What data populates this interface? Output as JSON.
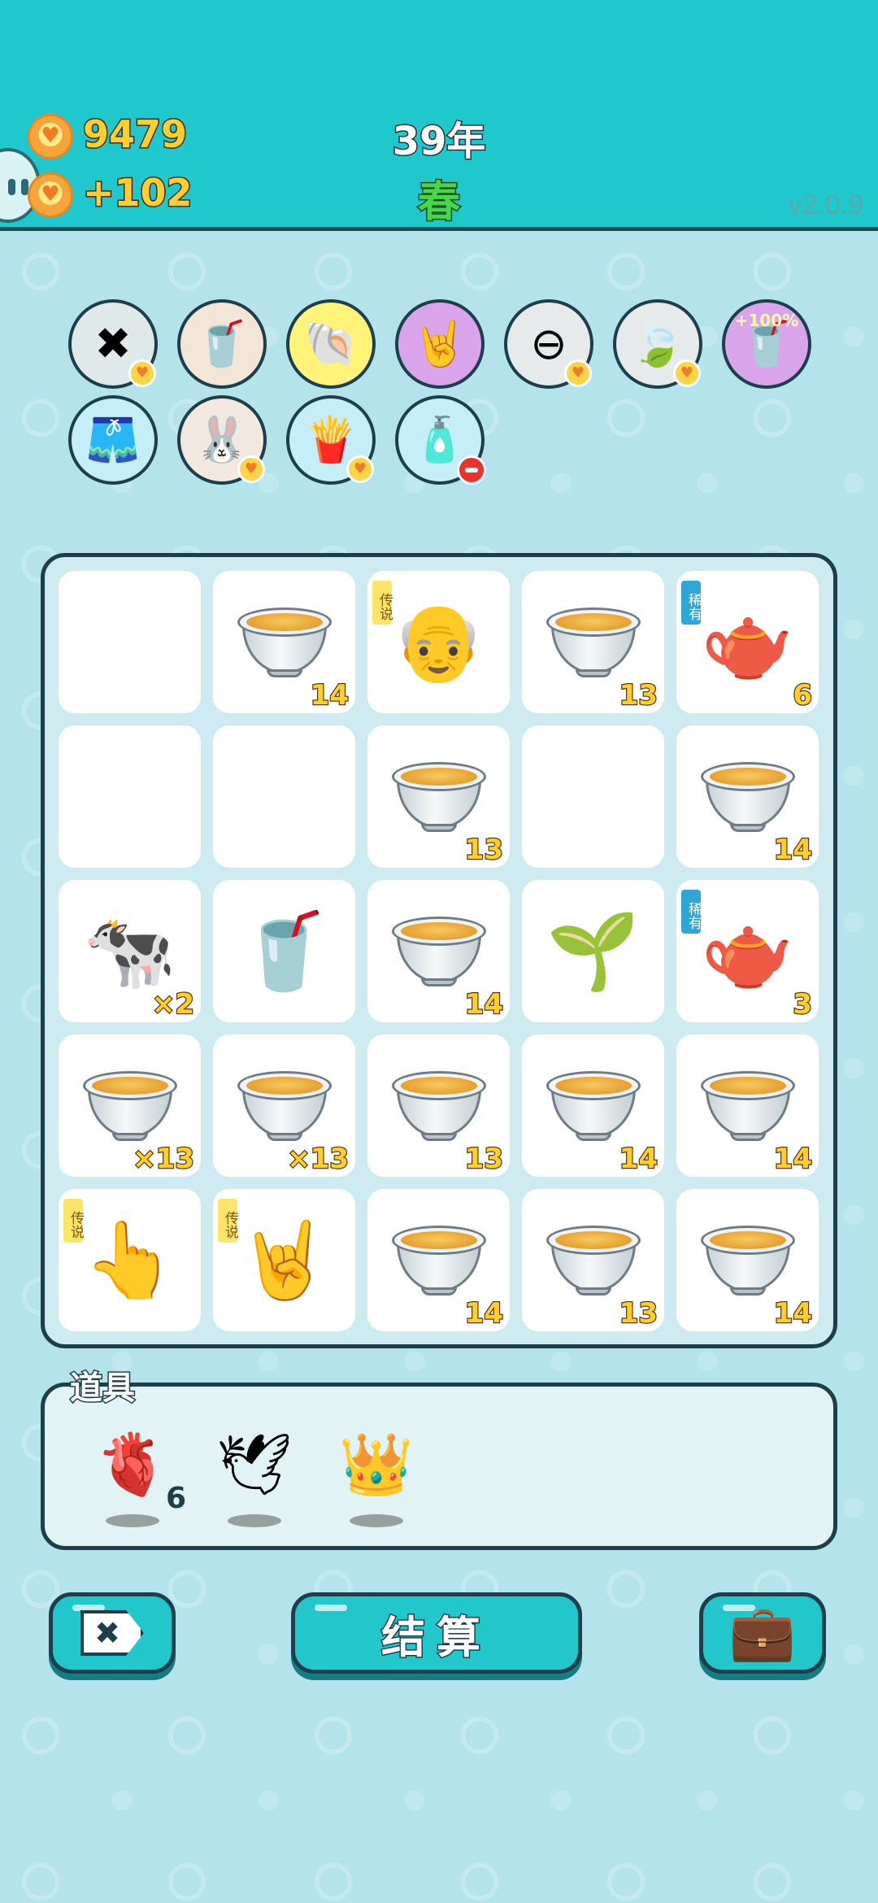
{
  "header": {
    "coins": "9479",
    "income": "+102",
    "year": "39年",
    "season": "春",
    "version": "v2.0.9"
  },
  "buffs": [
    {
      "name": "delete-ticket",
      "icon": "delete-tag-icon",
      "emoji": "✖",
      "bg": "#dfe9ea",
      "badge": "coin"
    },
    {
      "name": "milk-tea-lid",
      "icon": "covered-cup-icon",
      "emoji": "🥤",
      "bg": "#f3e6d6",
      "badge": ""
    },
    {
      "name": "shell",
      "icon": "shell-icon",
      "emoji": "🐚",
      "bg": "#fff37a",
      "badge": ""
    },
    {
      "name": "rock-hand",
      "icon": "rock-hand-icon",
      "emoji": "🤘",
      "bg": "#d9a4ea",
      "badge": ""
    },
    {
      "name": "minus",
      "icon": "minus-circle-icon",
      "emoji": "⊖",
      "bg": "#e6eaeb",
      "badge": "coin"
    },
    {
      "name": "leaf",
      "icon": "leaf-icon",
      "emoji": "🍃",
      "bg": "#e6eaeb",
      "badge": "coin"
    },
    {
      "name": "double-tea",
      "icon": "cup-boost-icon",
      "emoji": "🥤",
      "bg": "#d9a4ea",
      "badge": "",
      "label": "+100%"
    },
    {
      "name": "skirt",
      "icon": "skirt-icon",
      "emoji": "🩳",
      "bg": "#c6eef8",
      "badge": ""
    },
    {
      "name": "rabbit",
      "icon": "rabbit-icon",
      "emoji": "🐰",
      "bg": "#f2e8df",
      "badge": "coin"
    },
    {
      "name": "fries",
      "icon": "fries-icon",
      "emoji": "🍟",
      "bg": "#c6eef8",
      "badge": "coin"
    },
    {
      "name": "tea-bag",
      "icon": "tea-sack-icon",
      "emoji": "🧴",
      "bg": "#c6eef8",
      "badge": "minus"
    }
  ],
  "board": [
    {
      "type": "empty"
    },
    {
      "type": "bowl",
      "count": "14"
    },
    {
      "type": "emoji",
      "icon": "grandpa-face-icon",
      "emoji": "👴",
      "tag": "legend",
      "tag_text": "传说"
    },
    {
      "type": "bowl",
      "count": "13"
    },
    {
      "type": "emoji",
      "icon": "teapot-icon",
      "emoji": "🫖",
      "tag": "rare",
      "tag_text": "稀有",
      "count": "6"
    },
    {
      "type": "empty"
    },
    {
      "type": "empty"
    },
    {
      "type": "bowl",
      "count": "13"
    },
    {
      "type": "empty"
    },
    {
      "type": "bowl",
      "count": "14"
    },
    {
      "type": "emoji",
      "icon": "cow-icon",
      "emoji": "🐄",
      "count": "×2"
    },
    {
      "type": "emoji",
      "icon": "bubble-tea-cup-icon",
      "emoji": "🥤"
    },
    {
      "type": "bowl",
      "count": "14"
    },
    {
      "type": "emoji",
      "icon": "sprout-icon",
      "emoji": "🌱"
    },
    {
      "type": "emoji",
      "icon": "teapot-icon",
      "emoji": "🫖",
      "tag": "rare",
      "tag_text": "稀有",
      "count": "3"
    },
    {
      "type": "bowl",
      "count": "×13"
    },
    {
      "type": "bowl",
      "count": "×13"
    },
    {
      "type": "bowl",
      "count": "13"
    },
    {
      "type": "bowl",
      "count": "14"
    },
    {
      "type": "bowl",
      "count": "14"
    },
    {
      "type": "emoji",
      "icon": "pointing-hand-icon",
      "emoji": "👆",
      "tag": "legend",
      "tag_text": "传说"
    },
    {
      "type": "emoji",
      "icon": "rock-hand-icon",
      "emoji": "🤘",
      "tag": "legend",
      "tag_text": "传说"
    },
    {
      "type": "bowl",
      "count": "14"
    },
    {
      "type": "bowl",
      "count": "13"
    },
    {
      "type": "bowl",
      "count": "14"
    }
  ],
  "items": {
    "title": "道具",
    "list": [
      {
        "icon": "liver-icon",
        "emoji": "🫀",
        "count": "6"
      },
      {
        "icon": "white-bird-icon",
        "emoji": "🕊",
        "count": ""
      },
      {
        "icon": "crown-icon",
        "emoji": "👑",
        "count": ""
      }
    ]
  },
  "buttons": {
    "delete_icon": "✖",
    "settle_label": "结算",
    "bag_icon": "💼"
  }
}
